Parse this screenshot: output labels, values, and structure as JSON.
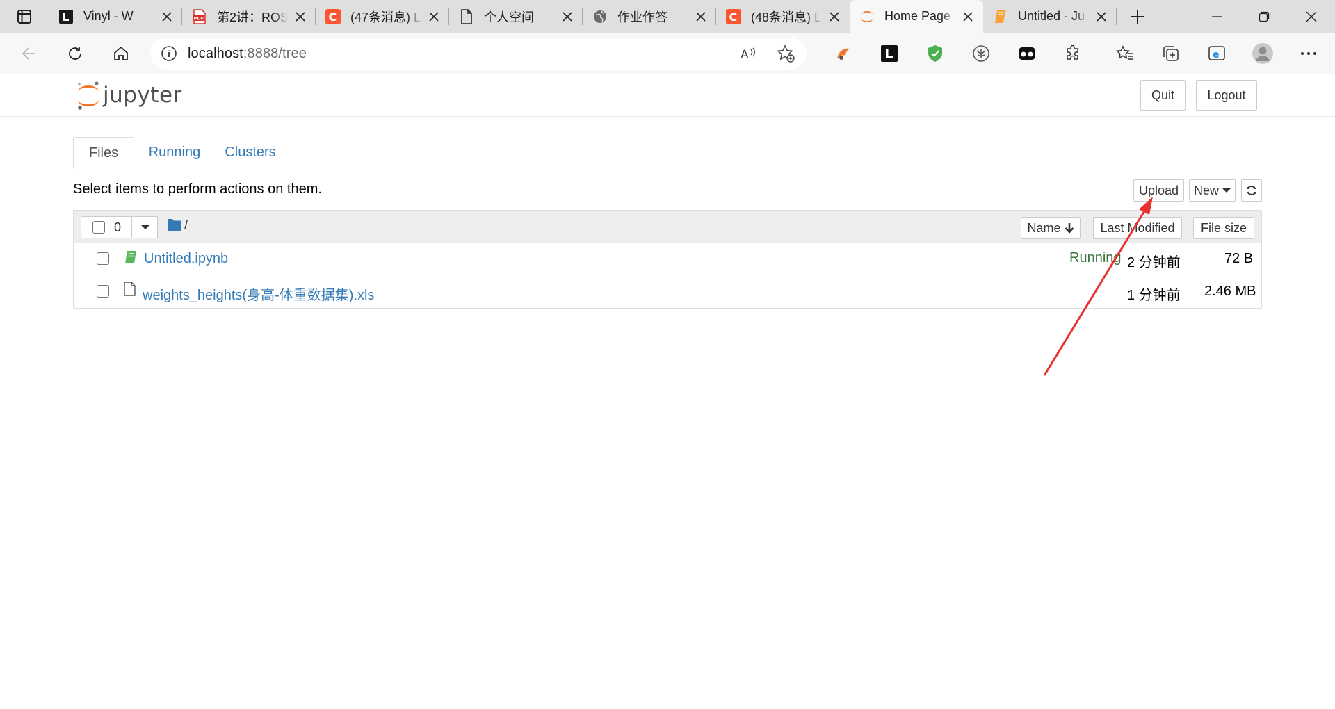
{
  "browser": {
    "tabs": [
      {
        "title": "Vinyl - W",
        "icon": "vinyl-l-icon",
        "active": false
      },
      {
        "title": "第2讲：ROS",
        "icon": "pdf-icon",
        "active": false
      },
      {
        "title": "(47条消息) L",
        "icon": "csdn-icon",
        "active": false
      },
      {
        "title": "个人空间",
        "icon": "document-icon",
        "active": false
      },
      {
        "title": "作业作答",
        "icon": "globe-icon",
        "active": false
      },
      {
        "title": "(48条消息) L",
        "icon": "csdn-icon",
        "active": false
      },
      {
        "title": "Home Page",
        "icon": "jupyter-icon",
        "active": true
      },
      {
        "title": "Untitled - Ju",
        "icon": "notebook-icon",
        "active": false
      }
    ],
    "address": {
      "host": "localhost",
      "rest": ":8888/tree"
    },
    "colors": {
      "tabstrip": "#dfdfdf",
      "toolbar": "#f7f7f7"
    }
  },
  "jupyter": {
    "logo_text": "jupyter",
    "header_buttons": {
      "quit": "Quit",
      "logout": "Logout"
    },
    "tabs": {
      "files": "Files",
      "running": "Running",
      "clusters": "Clusters"
    },
    "hint": "Select items to perform actions on them.",
    "actions": {
      "upload": "Upload",
      "new": "New"
    },
    "list_header": {
      "selected_count": "0",
      "breadcrumb": "/",
      "sort_name": "Name",
      "sort_modified": "Last Modified",
      "sort_size": "File size"
    },
    "files": [
      {
        "name": "Untitled.ipynb",
        "type": "notebook",
        "status": "Running",
        "modified": "2 分钟前",
        "size": "72 B"
      },
      {
        "name": "weights_heights(身高-体重数据集).xls",
        "type": "file",
        "status": "",
        "modified": "1 分钟前",
        "size": "2.46 MB"
      }
    ],
    "colors": {
      "link": "#337ab7",
      "running": "#3c763d",
      "logo_orange": "#f37726",
      "annotation_arrow": "#e8312f"
    }
  }
}
